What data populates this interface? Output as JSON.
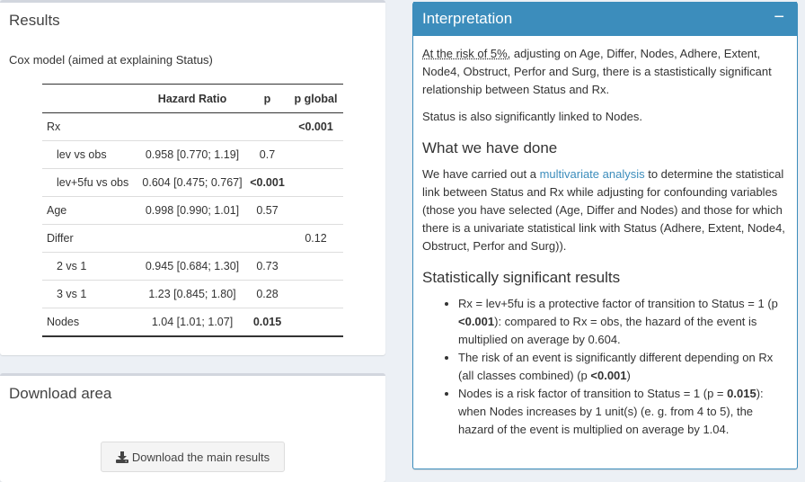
{
  "results": {
    "title": "Results",
    "subtitle": "Cox model (aimed at explaining Status)",
    "table": {
      "headers": [
        "",
        "Hazard Ratio",
        "p",
        "p global"
      ],
      "rows": [
        {
          "label": "Rx",
          "hr": "",
          "p": "",
          "pglobal": "<0.001",
          "indent": false,
          "p_bold": false,
          "pg_bold": true
        },
        {
          "label": "lev vs obs",
          "hr": "0.958 [0.770; 1.19]",
          "p": "0.7",
          "pglobal": "",
          "indent": true,
          "p_bold": false,
          "pg_bold": false
        },
        {
          "label": "lev+5fu vs obs",
          "hr": "0.604 [0.475; 0.767]",
          "p": "<0.001",
          "pglobal": "",
          "indent": true,
          "p_bold": true,
          "pg_bold": false
        },
        {
          "label": "Age",
          "hr": "0.998 [0.990; 1.01]",
          "p": "0.57",
          "pglobal": "",
          "indent": false,
          "p_bold": false,
          "pg_bold": false
        },
        {
          "label": "Differ",
          "hr": "",
          "p": "",
          "pglobal": "0.12",
          "indent": false,
          "p_bold": false,
          "pg_bold": false
        },
        {
          "label": "2 vs 1",
          "hr": "0.945 [0.684; 1.30]",
          "p": "0.73",
          "pglobal": "",
          "indent": true,
          "p_bold": false,
          "pg_bold": false
        },
        {
          "label": "3 vs 1",
          "hr": "1.23 [0.845; 1.80]",
          "p": "0.28",
          "pglobal": "",
          "indent": true,
          "p_bold": false,
          "pg_bold": false
        },
        {
          "label": "Nodes",
          "hr": "1.04 [1.01; 1.07]",
          "p": "0.015",
          "pglobal": "",
          "indent": false,
          "p_bold": true,
          "pg_bold": false
        }
      ]
    }
  },
  "download": {
    "title": "Download area",
    "button_label": "Download the main results",
    "button_icon": "download-icon"
  },
  "interpretation": {
    "title": "Interpretation",
    "collapse_label": "−",
    "p1_risk": "At the risk of 5%,",
    "p1_rest": " adjusting on Age, Differ, Nodes, Adhere, Extent, Node4, Obstruct, Perfor and Surg, there is a stastistically significant relationship between Status and Rx.",
    "p2": "Status is also significantly linked to Nodes.",
    "h_done": "What we have done",
    "p3_pre": "We have carried out a ",
    "p3_link": "multivariate analysis",
    "p3_post": " to determine the statistical link between Status and Rx while adjusting for confounding variables (those you have selected (Age, Differ and Nodes) and those for which there is a univariate statistical link with Status (Adhere, Extent, Node4, Obstruct, Perfor and Surg)).",
    "h_sig": "Statistically significant results",
    "bullets": {
      "b1_a": "Rx = lev+5fu is a protective factor of transition to Status = 1 (p ",
      "b1_bold": "<0.001",
      "b1_b": "): compared to Rx = obs, the hazard of the event is multiplied on average by 0.604.",
      "b2_a": "The risk of an event is significantly different depending on Rx (all classes combined) (p ",
      "b2_bold": "<0.001",
      "b2_b": ")",
      "b3_a": "Nodes is a risk factor of transition to Status = 1 (p = ",
      "b3_bold": "0.015",
      "b3_b": "): when Nodes increases by 1 unit(s) (e. g. from 4 to 5), the hazard of the event is multiplied on average by 1.04."
    }
  }
}
